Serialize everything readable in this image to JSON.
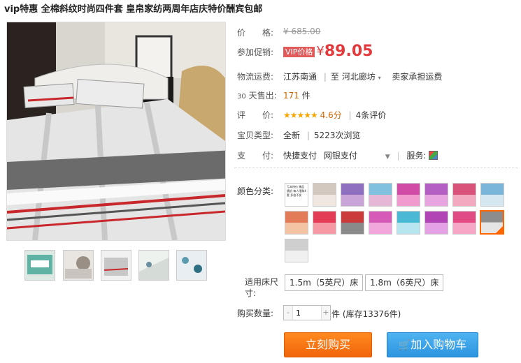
{
  "title": "vip特惠 全棉斜纹时尚四件套 皇帛家纺两周年店庆特价酬宾包邮",
  "price": {
    "label": "价　　格:",
    "value": "¥ 685.00"
  },
  "promo": {
    "label": "参加促销:",
    "tag": "VIP价格",
    "symbol": "¥",
    "value": "89.05"
  },
  "shipping": {
    "label": "物流运费:",
    "from": "江苏南通",
    "to_prefix": "至",
    "to": "河北廊坊",
    "fee": "卖家承担运费"
  },
  "sold": {
    "label_small": "30",
    "label": "天售出:",
    "count": "171",
    "unit": "件"
  },
  "rating": {
    "label": "评　　价:",
    "stars": "★★★★★",
    "score": "4.6分",
    "reviews": "4条评价"
  },
  "type": {
    "label": "宝贝类型:",
    "value": "全新",
    "views": "5223次浏览"
  },
  "pay": {
    "label": "支　　付:",
    "method1": "快捷支付",
    "method2": "网银支付",
    "service_label": "服务:"
  },
  "color": {
    "label": "颜色分类:",
    "first_text": "亏本特价 赠品随机 每人限购4套 多拍不发"
  },
  "size": {
    "label": "适用床尺寸:",
    "options": [
      "1.5m（5英尺）床",
      "1.8m（6英尺）床"
    ]
  },
  "qty": {
    "label": "购买数量:",
    "value": "1",
    "stock": "件 (库存13376件)"
  },
  "buttons": {
    "buy": "立刻购买",
    "cart": "加入购物车"
  },
  "colors": {
    "accent": "#e4393c",
    "buy": "#f0640a",
    "cart": "#2c95e0"
  }
}
